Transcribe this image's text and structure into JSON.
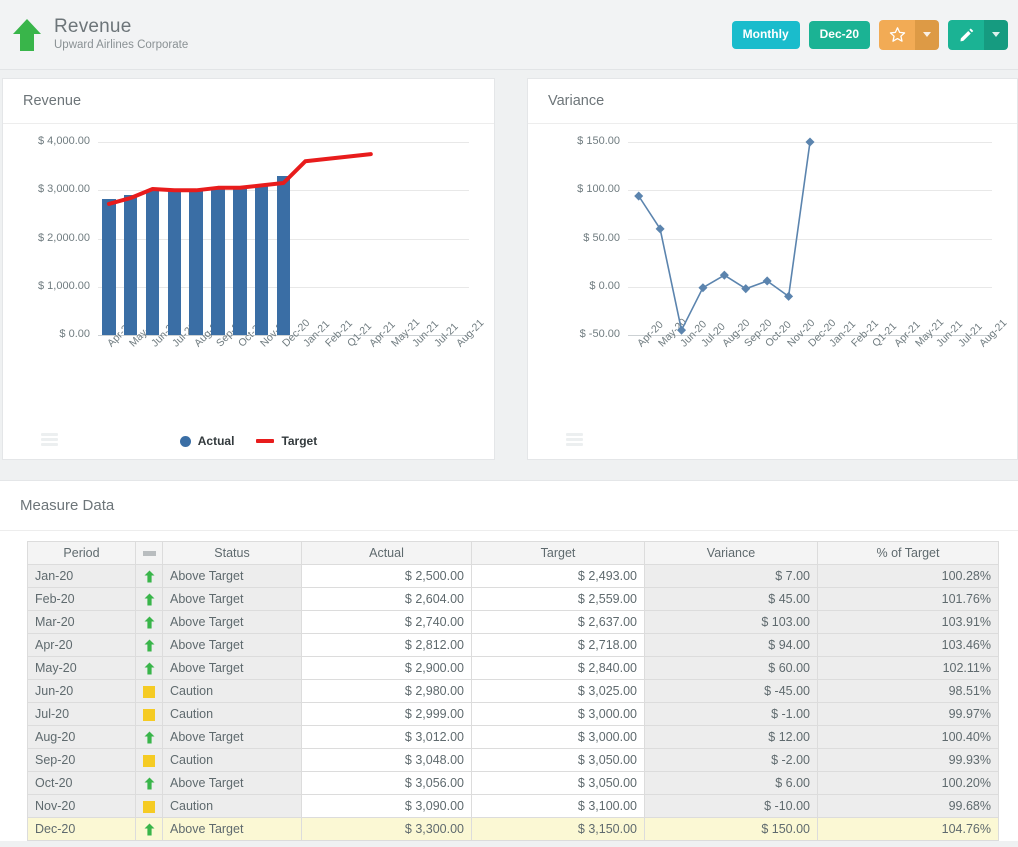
{
  "header": {
    "title": "Revenue",
    "subtitle": "Upward Airlines Corporate",
    "logo_icon": "upward-arrow-icon",
    "period_pill": "Monthly",
    "date_pill": "Dec-20",
    "favorite_icon": "star-icon",
    "favorite_caret_icon": "chevron-down-icon",
    "edit_icon": "pencil-icon",
    "edit_caret_icon": "chevron-down-icon"
  },
  "panels": {
    "revenue_title": "Revenue",
    "variance_title": "Variance",
    "measure_title": "Measure Data",
    "menu_icon": "hamburger-menu-icon"
  },
  "chart_data": [
    {
      "type": "bar",
      "title": "Revenue",
      "xlabel": "",
      "ylabel": "",
      "ylim": [
        0,
        4000
      ],
      "yticks": [
        0,
        1000,
        2000,
        3000,
        4000
      ],
      "ytick_labels": [
        "$ 0.00",
        "$ 1,000.00",
        "$ 2,000.00",
        "$ 3,000.00",
        "$ 4,000.00"
      ],
      "grid": true,
      "legend_position": "bottom",
      "categories": [
        "Apr-20",
        "May-20",
        "Jun-20",
        "Jul-20",
        "Aug-20",
        "Sep-20",
        "Oct-20",
        "Nov-20",
        "Dec-20",
        "Jan-21",
        "Feb-21",
        "Q1-21",
        "Apr-21",
        "May-21",
        "Jun-21",
        "Jul-21",
        "Aug-21"
      ],
      "series": [
        {
          "name": "Actual",
          "color": "#3a6ea5",
          "kind": "bar",
          "values": [
            2812,
            2900,
            2980,
            2999,
            3012,
            3048,
            3056,
            3090,
            3300,
            null,
            null,
            null,
            null,
            null,
            null,
            null,
            null
          ]
        },
        {
          "name": "Target",
          "color": "#e81c1c",
          "kind": "line",
          "values": [
            2718,
            2840,
            3025,
            3000,
            3000,
            3050,
            3050,
            3100,
            3150,
            3600,
            3650,
            3700,
            3750,
            null,
            null,
            null,
            null
          ]
        }
      ]
    },
    {
      "type": "line",
      "title": "Variance",
      "xlabel": "",
      "ylabel": "",
      "ylim": [
        -50,
        150
      ],
      "yticks": [
        -50,
        0,
        50,
        100,
        150
      ],
      "ytick_labels": [
        "$ -50.00",
        "$ 0.00",
        "$ 50.00",
        "$ 100.00",
        "$ 150.00"
      ],
      "grid": true,
      "legend_position": "none",
      "categories": [
        "Apr-20",
        "May-20",
        "Jun-20",
        "Jul-20",
        "Aug-20",
        "Sep-20",
        "Oct-20",
        "Nov-20",
        "Dec-20",
        "Jan-21",
        "Feb-21",
        "Q1-21",
        "Apr-21",
        "May-21",
        "Jun-21",
        "Jul-21",
        "Aug-21"
      ],
      "series": [
        {
          "name": "Variance",
          "color": "#5b84ae",
          "kind": "line",
          "values": [
            94,
            60,
            -45,
            -1,
            12,
            -2,
            6,
            -10,
            150,
            null,
            null,
            null,
            null,
            null,
            null,
            null,
            null
          ]
        }
      ]
    }
  ],
  "table": {
    "columns": [
      "Period",
      "—",
      "Status",
      "Actual",
      "Target",
      "Variance",
      "% of Target"
    ],
    "rows": [
      {
        "period": "Jan-20",
        "flag": "arrow-up",
        "status": "Above Target",
        "actual": "$ 2,500.00",
        "target": "$ 2,493.00",
        "variance": "$ 7.00",
        "pct": "100.28%",
        "highlight": false
      },
      {
        "period": "Feb-20",
        "flag": "arrow-up",
        "status": "Above Target",
        "actual": "$ 2,604.00",
        "target": "$ 2,559.00",
        "variance": "$ 45.00",
        "pct": "101.76%",
        "highlight": false
      },
      {
        "period": "Mar-20",
        "flag": "arrow-up",
        "status": "Above Target",
        "actual": "$ 2,740.00",
        "target": "$ 2,637.00",
        "variance": "$ 103.00",
        "pct": "103.91%",
        "highlight": false
      },
      {
        "period": "Apr-20",
        "flag": "arrow-up",
        "status": "Above Target",
        "actual": "$ 2,812.00",
        "target": "$ 2,718.00",
        "variance": "$ 94.00",
        "pct": "103.46%",
        "highlight": false
      },
      {
        "period": "May-20",
        "flag": "arrow-up",
        "status": "Above Target",
        "actual": "$ 2,900.00",
        "target": "$ 2,840.00",
        "variance": "$ 60.00",
        "pct": "102.11%",
        "highlight": false
      },
      {
        "period": "Jun-20",
        "flag": "caution",
        "status": "Caution",
        "actual": "$ 2,980.00",
        "target": "$ 3,025.00",
        "variance": "$ -45.00",
        "pct": "98.51%",
        "highlight": false
      },
      {
        "period": "Jul-20",
        "flag": "caution",
        "status": "Caution",
        "actual": "$ 2,999.00",
        "target": "$ 3,000.00",
        "variance": "$ -1.00",
        "pct": "99.97%",
        "highlight": false
      },
      {
        "period": "Aug-20",
        "flag": "arrow-up",
        "status": "Above Target",
        "actual": "$ 3,012.00",
        "target": "$ 3,000.00",
        "variance": "$ 12.00",
        "pct": "100.40%",
        "highlight": false
      },
      {
        "period": "Sep-20",
        "flag": "caution",
        "status": "Caution",
        "actual": "$ 3,048.00",
        "target": "$ 3,050.00",
        "variance": "$ -2.00",
        "pct": "99.93%",
        "highlight": false
      },
      {
        "period": "Oct-20",
        "flag": "arrow-up",
        "status": "Above Target",
        "actual": "$ 3,056.00",
        "target": "$ 3,050.00",
        "variance": "$ 6.00",
        "pct": "100.20%",
        "highlight": false
      },
      {
        "period": "Nov-20",
        "flag": "caution",
        "status": "Caution",
        "actual": "$ 3,090.00",
        "target": "$ 3,100.00",
        "variance": "$ -10.00",
        "pct": "99.68%",
        "highlight": false
      },
      {
        "period": "Dec-20",
        "flag": "arrow-up",
        "status": "Above Target",
        "actual": "$ 3,300.00",
        "target": "$ 3,150.00",
        "variance": "$ 150.00",
        "pct": "104.76%",
        "highlight": true
      }
    ]
  },
  "colors": {
    "accent_cyan": "#1abccc",
    "accent_green": "#1bb394",
    "accent_orange": "#f2ab55",
    "bar_blue": "#3a6ea5",
    "target_red": "#e81c1c",
    "variance_blue": "#5b84ae",
    "status_green": "#39b54a",
    "status_yellow": "#f5cb23",
    "highlight_row": "#fbf8d4"
  }
}
